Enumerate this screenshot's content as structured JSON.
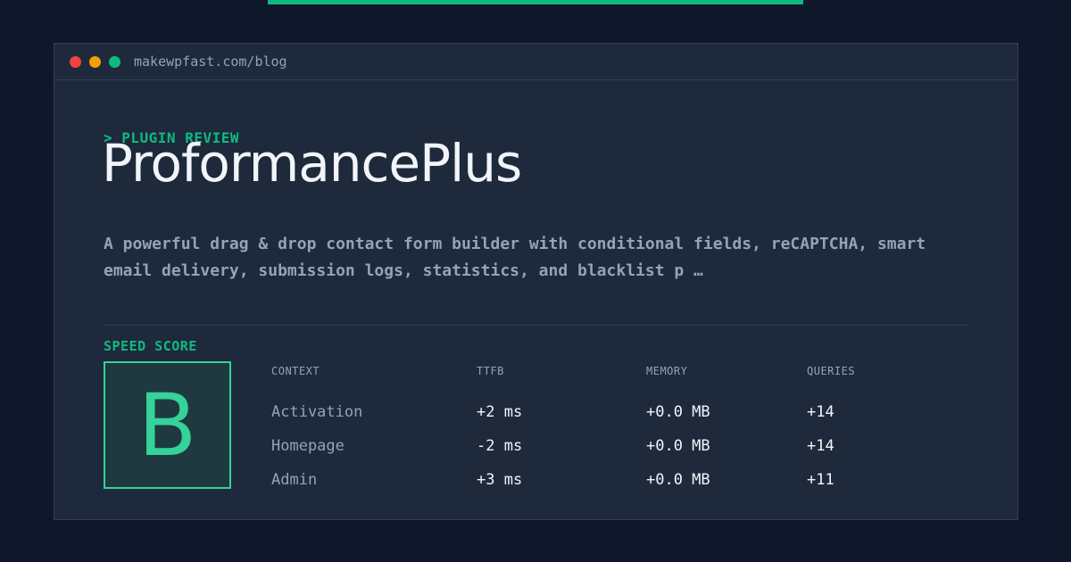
{
  "window": {
    "url": "makewpfast.com/blog"
  },
  "header": {
    "kicker": "> PLUGIN REVIEW",
    "title": "ProformancePlus",
    "description": "A powerful drag & drop contact form builder with conditional fields, reCAPTCHA, smart email delivery, submission logs, statistics, and blacklist p …"
  },
  "score": {
    "label": "SPEED SCORE",
    "grade": "B"
  },
  "table": {
    "headers": [
      "CONTEXT",
      "TTFB",
      "MEMORY",
      "QUERIES"
    ],
    "rows": [
      [
        "Activation",
        "+2 ms",
        "+0.0 MB",
        "+14"
      ],
      [
        "Homepage",
        "-2 ms",
        "+0.0 MB",
        "+14"
      ],
      [
        "Admin",
        "+3 ms",
        "+0.0 MB",
        "+11"
      ]
    ]
  },
  "colors": {
    "background": "#0f172a",
    "panel": "#1e293b",
    "accent": "#10b981",
    "grade": "#34d399"
  }
}
